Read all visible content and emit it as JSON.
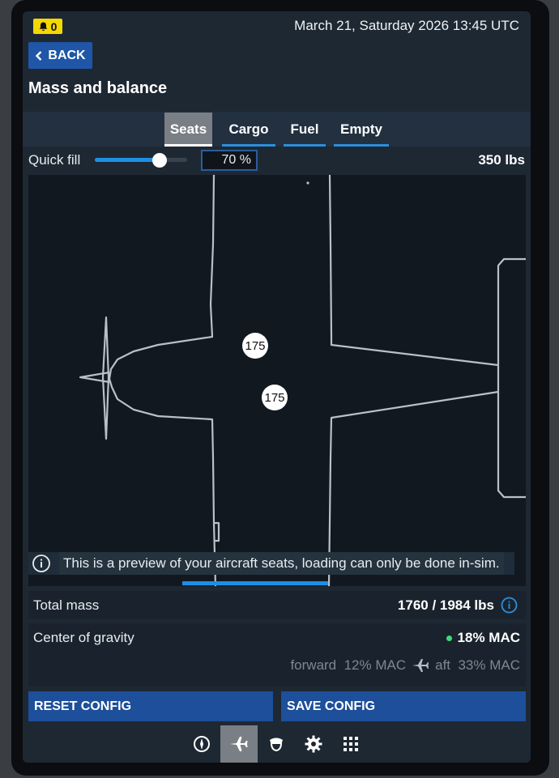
{
  "status": {
    "notification_count": "0",
    "datetime": "March 21, Saturday 2026 13:45 UTC"
  },
  "header": {
    "back_label": "BACK",
    "title": "Mass and balance"
  },
  "tabs": [
    {
      "label": "Seats",
      "active": true
    },
    {
      "label": "Cargo",
      "active": false
    },
    {
      "label": "Fuel",
      "active": false
    },
    {
      "label": "Empty",
      "active": false
    }
  ],
  "quick_fill": {
    "label": "Quick fill",
    "percent": 70,
    "value_text": "70 %",
    "total": "350 lbs"
  },
  "seats": [
    {
      "weight": "175"
    },
    {
      "weight": "175"
    }
  ],
  "preview_note": "This is a preview of your aircraft seats, loading can only be done in-sim.",
  "total_mass": {
    "label": "Total mass",
    "value": "1760 / 1984 lbs"
  },
  "center_of_gravity": {
    "label": "Center of gravity",
    "value": "18% MAC",
    "forward": "forward  12% MAC",
    "aft": "aft  33% MAC",
    "status_color": "#3ddc7a"
  },
  "actions": {
    "reset_label": "RESET CONFIG",
    "save_label": "SAVE CONFIG"
  },
  "nav": [
    {
      "icon": "compass-icon",
      "active": false
    },
    {
      "icon": "airplane-icon",
      "active": true
    },
    {
      "icon": "pilot-icon",
      "active": false
    },
    {
      "icon": "gear-icon",
      "active": false
    },
    {
      "icon": "apps-grid-icon",
      "active": false
    }
  ],
  "colors": {
    "accent": "#1e8fe6",
    "button": "#1d4f9a",
    "badge": "#f5d800"
  }
}
